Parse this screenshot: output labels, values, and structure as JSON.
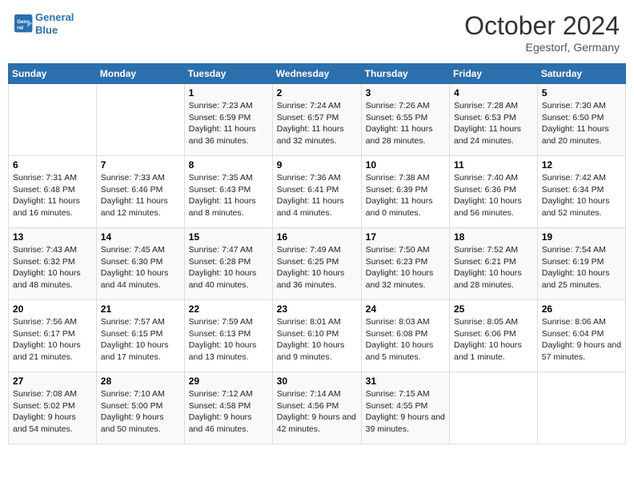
{
  "header": {
    "logo_line1": "General",
    "logo_line2": "Blue",
    "month_title": "October 2024",
    "location": "Egestorf, Germany"
  },
  "weekdays": [
    "Sunday",
    "Monday",
    "Tuesday",
    "Wednesday",
    "Thursday",
    "Friday",
    "Saturday"
  ],
  "weeks": [
    [
      {
        "day": "",
        "sunrise": "",
        "sunset": "",
        "daylight": ""
      },
      {
        "day": "",
        "sunrise": "",
        "sunset": "",
        "daylight": ""
      },
      {
        "day": "1",
        "sunrise": "Sunrise: 7:23 AM",
        "sunset": "Sunset: 6:59 PM",
        "daylight": "Daylight: 11 hours and 36 minutes."
      },
      {
        "day": "2",
        "sunrise": "Sunrise: 7:24 AM",
        "sunset": "Sunset: 6:57 PM",
        "daylight": "Daylight: 11 hours and 32 minutes."
      },
      {
        "day": "3",
        "sunrise": "Sunrise: 7:26 AM",
        "sunset": "Sunset: 6:55 PM",
        "daylight": "Daylight: 11 hours and 28 minutes."
      },
      {
        "day": "4",
        "sunrise": "Sunrise: 7:28 AM",
        "sunset": "Sunset: 6:53 PM",
        "daylight": "Daylight: 11 hours and 24 minutes."
      },
      {
        "day": "5",
        "sunrise": "Sunrise: 7:30 AM",
        "sunset": "Sunset: 6:50 PM",
        "daylight": "Daylight: 11 hours and 20 minutes."
      }
    ],
    [
      {
        "day": "6",
        "sunrise": "Sunrise: 7:31 AM",
        "sunset": "Sunset: 6:48 PM",
        "daylight": "Daylight: 11 hours and 16 minutes."
      },
      {
        "day": "7",
        "sunrise": "Sunrise: 7:33 AM",
        "sunset": "Sunset: 6:46 PM",
        "daylight": "Daylight: 11 hours and 12 minutes."
      },
      {
        "day": "8",
        "sunrise": "Sunrise: 7:35 AM",
        "sunset": "Sunset: 6:43 PM",
        "daylight": "Daylight: 11 hours and 8 minutes."
      },
      {
        "day": "9",
        "sunrise": "Sunrise: 7:36 AM",
        "sunset": "Sunset: 6:41 PM",
        "daylight": "Daylight: 11 hours and 4 minutes."
      },
      {
        "day": "10",
        "sunrise": "Sunrise: 7:38 AM",
        "sunset": "Sunset: 6:39 PM",
        "daylight": "Daylight: 11 hours and 0 minutes."
      },
      {
        "day": "11",
        "sunrise": "Sunrise: 7:40 AM",
        "sunset": "Sunset: 6:36 PM",
        "daylight": "Daylight: 10 hours and 56 minutes."
      },
      {
        "day": "12",
        "sunrise": "Sunrise: 7:42 AM",
        "sunset": "Sunset: 6:34 PM",
        "daylight": "Daylight: 10 hours and 52 minutes."
      }
    ],
    [
      {
        "day": "13",
        "sunrise": "Sunrise: 7:43 AM",
        "sunset": "Sunset: 6:32 PM",
        "daylight": "Daylight: 10 hours and 48 minutes."
      },
      {
        "day": "14",
        "sunrise": "Sunrise: 7:45 AM",
        "sunset": "Sunset: 6:30 PM",
        "daylight": "Daylight: 10 hours and 44 minutes."
      },
      {
        "day": "15",
        "sunrise": "Sunrise: 7:47 AM",
        "sunset": "Sunset: 6:28 PM",
        "daylight": "Daylight: 10 hours and 40 minutes."
      },
      {
        "day": "16",
        "sunrise": "Sunrise: 7:49 AM",
        "sunset": "Sunset: 6:25 PM",
        "daylight": "Daylight: 10 hours and 36 minutes."
      },
      {
        "day": "17",
        "sunrise": "Sunrise: 7:50 AM",
        "sunset": "Sunset: 6:23 PM",
        "daylight": "Daylight: 10 hours and 32 minutes."
      },
      {
        "day": "18",
        "sunrise": "Sunrise: 7:52 AM",
        "sunset": "Sunset: 6:21 PM",
        "daylight": "Daylight: 10 hours and 28 minutes."
      },
      {
        "day": "19",
        "sunrise": "Sunrise: 7:54 AM",
        "sunset": "Sunset: 6:19 PM",
        "daylight": "Daylight: 10 hours and 25 minutes."
      }
    ],
    [
      {
        "day": "20",
        "sunrise": "Sunrise: 7:56 AM",
        "sunset": "Sunset: 6:17 PM",
        "daylight": "Daylight: 10 hours and 21 minutes."
      },
      {
        "day": "21",
        "sunrise": "Sunrise: 7:57 AM",
        "sunset": "Sunset: 6:15 PM",
        "daylight": "Daylight: 10 hours and 17 minutes."
      },
      {
        "day": "22",
        "sunrise": "Sunrise: 7:59 AM",
        "sunset": "Sunset: 6:13 PM",
        "daylight": "Daylight: 10 hours and 13 minutes."
      },
      {
        "day": "23",
        "sunrise": "Sunrise: 8:01 AM",
        "sunset": "Sunset: 6:10 PM",
        "daylight": "Daylight: 10 hours and 9 minutes."
      },
      {
        "day": "24",
        "sunrise": "Sunrise: 8:03 AM",
        "sunset": "Sunset: 6:08 PM",
        "daylight": "Daylight: 10 hours and 5 minutes."
      },
      {
        "day": "25",
        "sunrise": "Sunrise: 8:05 AM",
        "sunset": "Sunset: 6:06 PM",
        "daylight": "Daylight: 10 hours and 1 minute."
      },
      {
        "day": "26",
        "sunrise": "Sunrise: 8:06 AM",
        "sunset": "Sunset: 6:04 PM",
        "daylight": "Daylight: 9 hours and 57 minutes."
      }
    ],
    [
      {
        "day": "27",
        "sunrise": "Sunrise: 7:08 AM",
        "sunset": "Sunset: 5:02 PM",
        "daylight": "Daylight: 9 hours and 54 minutes."
      },
      {
        "day": "28",
        "sunrise": "Sunrise: 7:10 AM",
        "sunset": "Sunset: 5:00 PM",
        "daylight": "Daylight: 9 hours and 50 minutes."
      },
      {
        "day": "29",
        "sunrise": "Sunrise: 7:12 AM",
        "sunset": "Sunset: 4:58 PM",
        "daylight": "Daylight: 9 hours and 46 minutes."
      },
      {
        "day": "30",
        "sunrise": "Sunrise: 7:14 AM",
        "sunset": "Sunset: 4:56 PM",
        "daylight": "Daylight: 9 hours and 42 minutes."
      },
      {
        "day": "31",
        "sunrise": "Sunrise: 7:15 AM",
        "sunset": "Sunset: 4:55 PM",
        "daylight": "Daylight: 9 hours and 39 minutes."
      },
      {
        "day": "",
        "sunrise": "",
        "sunset": "",
        "daylight": ""
      },
      {
        "day": "",
        "sunrise": "",
        "sunset": "",
        "daylight": ""
      }
    ]
  ]
}
